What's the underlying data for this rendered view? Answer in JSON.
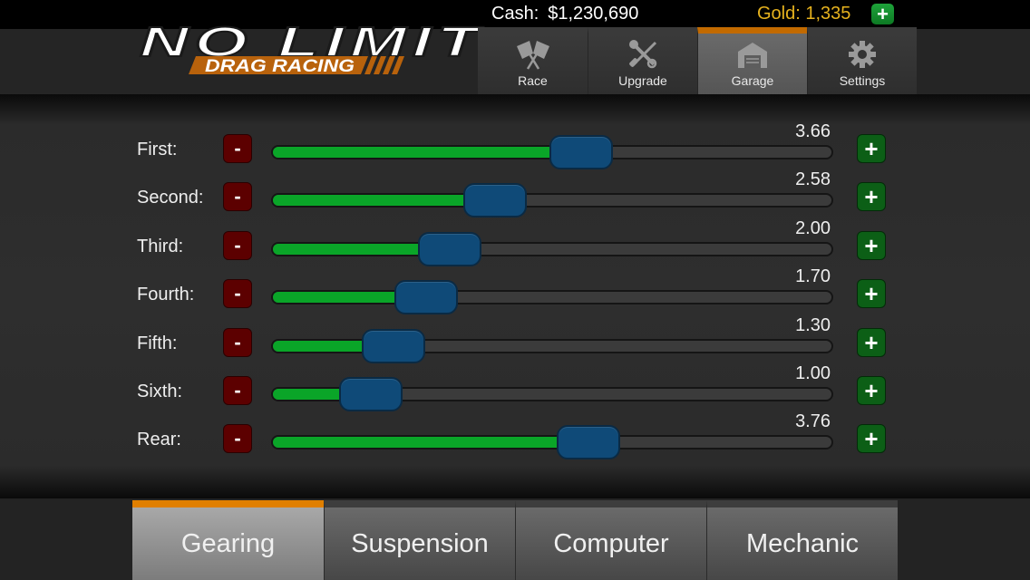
{
  "status": {
    "cash_label": "Cash:",
    "cash_value": "$1,230,690",
    "gold_text": "Gold: 1,335",
    "gold_add_label": "+"
  },
  "logo": {
    "title": "NO LIMIT",
    "subtitle": "DRAG RACING"
  },
  "nav": {
    "items": [
      {
        "label": "Race",
        "icon": "checkered-flags-icon",
        "active": false
      },
      {
        "label": "Upgrade",
        "icon": "wrench-screwdriver-icon",
        "active": false
      },
      {
        "label": "Garage",
        "icon": "garage-icon",
        "active": true
      },
      {
        "label": "Settings",
        "icon": "gear-icon",
        "active": false
      }
    ]
  },
  "gearing": {
    "decrement_label": "-",
    "increment_label": "+",
    "rows": [
      {
        "label": "First:",
        "value": "3.66",
        "fraction": 0.558
      },
      {
        "label": "Second:",
        "value": "2.58",
        "fraction": 0.385
      },
      {
        "label": "Third:",
        "value": "2.00",
        "fraction": 0.293
      },
      {
        "label": "Fourth:",
        "value": "1.70",
        "fraction": 0.245
      },
      {
        "label": "Fifth:",
        "value": "1.30",
        "fraction": 0.18
      },
      {
        "label": "Sixth:",
        "value": "1.00",
        "fraction": 0.133
      },
      {
        "label": "Rear:",
        "value": "3.76",
        "fraction": 0.573
      }
    ]
  },
  "tabs": [
    {
      "label": "Gearing",
      "active": true
    },
    {
      "label": "Suspension",
      "active": false
    },
    {
      "label": "Computer",
      "active": false
    },
    {
      "label": "Mechanic",
      "active": false
    }
  ],
  "colors": {
    "accent_orange": "#e07f00",
    "gold": "#e6b21e",
    "slider_fill": "#0aa528",
    "knob": "#0f4a78",
    "minus_button": "#5c0000",
    "plus_button": "#0c5f16"
  }
}
